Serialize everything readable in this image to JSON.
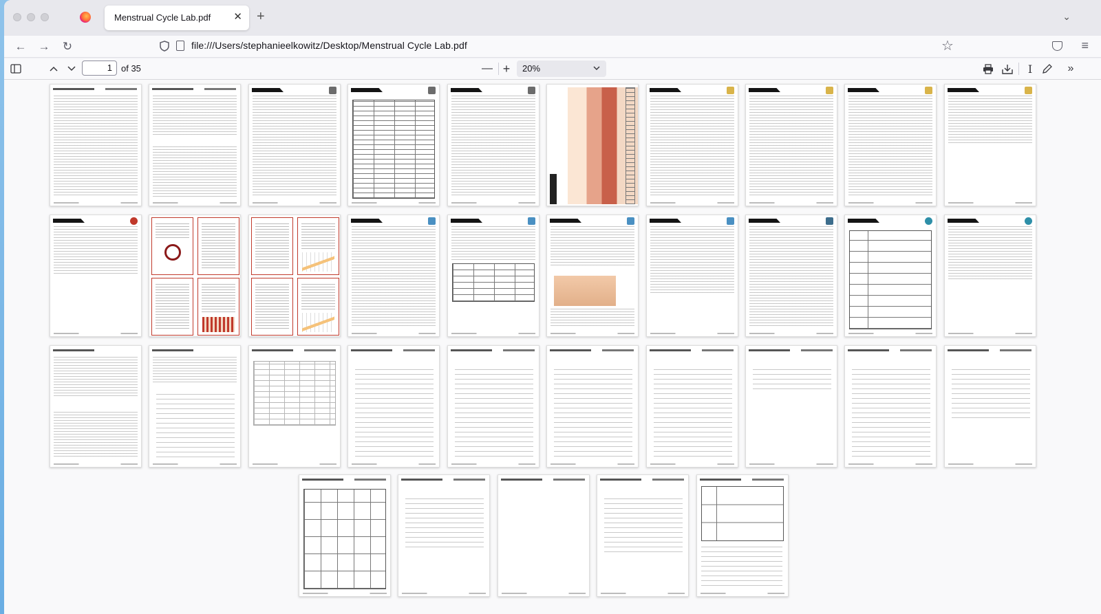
{
  "browser": {
    "tab_title": "Menstrual Cycle Lab.pdf",
    "tab_close_icon": "close-icon",
    "new_tab_label": "+",
    "url": "file:///Users/stephanieelkowitz/Desktop/Menstrual Cycle Lab.pdf"
  },
  "pdf_toolbar": {
    "current_page": "1",
    "page_count_label": "of 35",
    "zoom": "20%"
  },
  "thumbnails": {
    "total_pages": 35,
    "visible_rows": [
      [
        "text",
        "text",
        "skills",
        "skills",
        "skills",
        "uterus",
        "narrative",
        "narrative",
        "narrative",
        "narrative"
      ],
      [
        "assessment",
        "redcards",
        "redcards",
        "problem",
        "problem",
        "problem",
        "problem",
        "synthesis",
        "synthesis",
        "synthesis"
      ],
      [
        "text",
        "text",
        "graph",
        "ruled",
        "ruled",
        "ruled",
        "ruled",
        "ruled",
        "ruled",
        "ruled"
      ],
      [
        "table",
        "ruled",
        "blank",
        "ruled",
        "synthesis-sheet"
      ]
    ]
  },
  "colors": {
    "accent": "#c0392b",
    "background": "#6aaee3",
    "chrome": "#f0f0f4"
  }
}
